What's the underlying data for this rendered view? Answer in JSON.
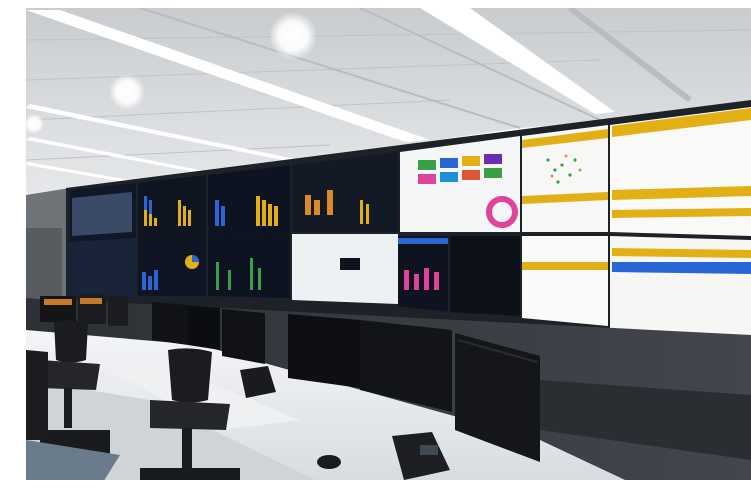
{
  "scene": {
    "description_type": "photo",
    "palette": {
      "ceiling": "#d9dbdc",
      "ceiling_light": "#ffffff",
      "wall": "#3a3d42",
      "screen_dark": "#0e1420",
      "accent_yellow": "#e2b015",
      "accent_blue": "#2a67d6",
      "accent_pink": "#e0449a",
      "desk": "#e9ebee",
      "monitor": "#111215",
      "chair": "#1b1c1f",
      "floor": "#6a7b8c"
    }
  }
}
